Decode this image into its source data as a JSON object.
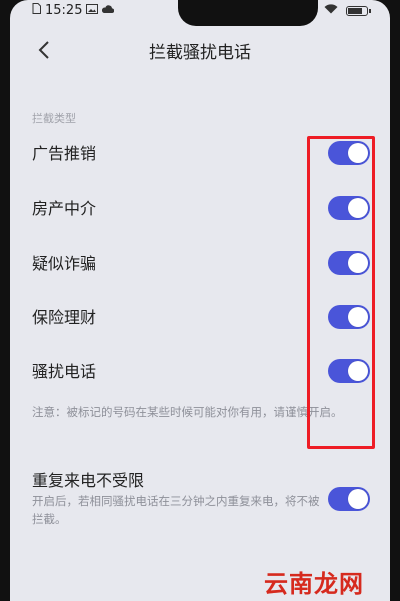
{
  "status": {
    "time": "15:25"
  },
  "header": {
    "title": "拦截骚扰电话"
  },
  "section": {
    "label": "拦截类型"
  },
  "items": [
    {
      "label": "广告推销",
      "on": true
    },
    {
      "label": "房产中介",
      "on": true
    },
    {
      "label": "疑似诈骗",
      "on": true
    },
    {
      "label": "保险理财",
      "on": true
    },
    {
      "label": "骚扰电话",
      "on": true
    }
  ],
  "note": "注意：被标记的号码在某些时候可能对你有用，请谨慎开启。",
  "repeat": {
    "label": "重复来电不受限",
    "desc": "开启后，若相同骚扰电话在三分钟之内重复来电，将不被拦截。",
    "on": true
  },
  "watermark": "云南龙网",
  "colors": {
    "toggle_on": "#4a55d9",
    "highlight_box": "#ee1c25",
    "background": "#e7e8ee"
  }
}
